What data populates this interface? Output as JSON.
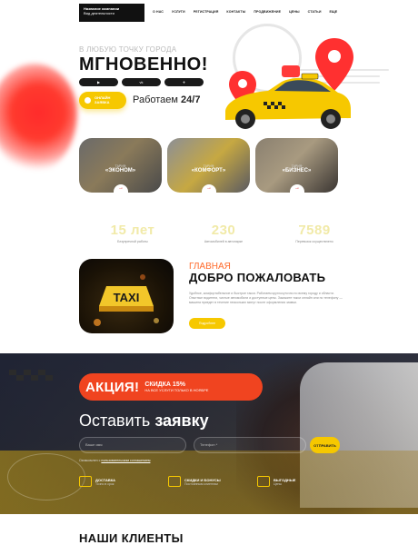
{
  "header": {
    "logo_line1": "Название компании",
    "logo_line2": "Вид деятельности",
    "nav": [
      "О НАС",
      "УСЛУГИ",
      "РЕГИСТРАЦИЯ",
      "КОНТАКТЫ",
      "ПРОДВИЖЕНИЕ",
      "ЦЕНЫ",
      "СТАТЬИ",
      "ЕЩЕ"
    ]
  },
  "hero": {
    "subtitle": "В ЛЮБУЮ ТОЧКУ ГОРОДА",
    "title": "МГНОВЕННО!",
    "social_youtube": "▶",
    "social_vk": "vk",
    "social_tg": "✈",
    "order_button": "ОНЛАЙН ЗАЯВКА",
    "works_prefix": "Работаем",
    "works_hours": "24/7"
  },
  "tariffs": [
    {
      "small": "ТАРИФ",
      "name": "«ЭКОНОМ»"
    },
    {
      "small": "ТАРИФ",
      "name": "«КОМФОРТ»"
    },
    {
      "small": "ТАРИФ",
      "name": "«БИЗНЕС»"
    }
  ],
  "stats": [
    {
      "num": "15 лет",
      "cap": "Безупречной работы"
    },
    {
      "num": "230",
      "cap": "Автомобилей в автопарке"
    },
    {
      "num": "7589",
      "cap": "Перевозок осуществлено"
    }
  ],
  "welcome": {
    "subtitle": "ГЛАВНАЯ",
    "title": "ДОБРО ПОЖАЛОВАТЬ",
    "taxi_sign": "TAXI",
    "text": "Удобное, комфортабельное и быстрое такси. Работаем круглосуточно по всему городу и области. Опытные водители, чистые автомобили и доступные цены. Закажите такси онлайн или по телефону — машина приедет в течение нескольких минут после оформления заявки.",
    "button": "Подробнее"
  },
  "promo": {
    "badge_big": "АКЦИЯ!",
    "badge_title": "СКИДКА 15%",
    "badge_sub": "НА ВСЕ УСЛУГИ ТОЛЬКО В НОЯБРЕ",
    "heading_light": "Оставить",
    "heading_bold": "заявку",
    "name_placeholder": "Ваше имя",
    "phone_placeholder": "Телефон *",
    "send_button": "ОТПРАВИТЬ",
    "consent_prefix": "Ознакомлен с",
    "consent_link": "пользовательским соглашением",
    "features": [
      {
        "title": "ДОСТАВКА",
        "sub": "Точно в срок"
      },
      {
        "title": "СКИДКИ И БОНУСЫ",
        "sub": "Постоянным клиентам"
      },
      {
        "title": "ВЫГОДНЫЕ",
        "sub": "Цены"
      }
    ]
  },
  "clients": {
    "title": "НАШИ КЛИЕНТЫ"
  },
  "colors": {
    "accent_yellow": "#f6c800",
    "accent_red": "#f04420",
    "dark": "#111111"
  }
}
